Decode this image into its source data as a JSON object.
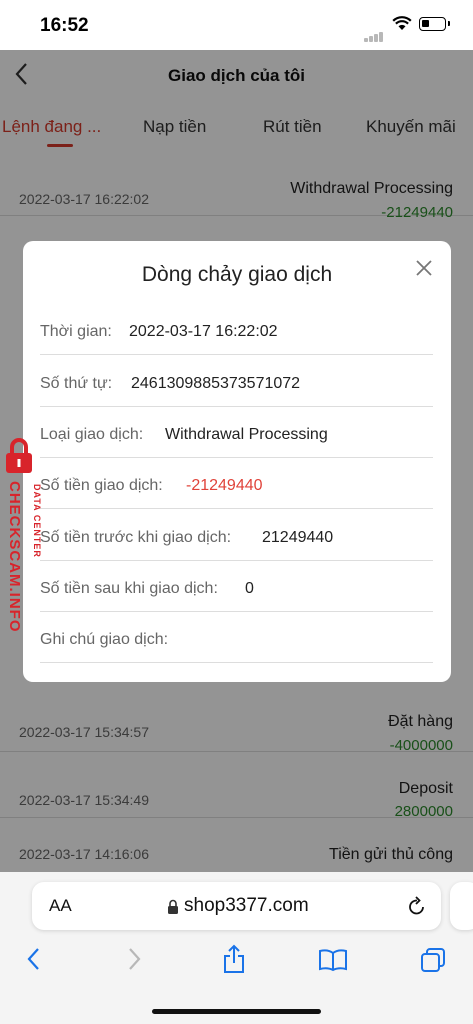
{
  "status_bar": {
    "time": "16:52"
  },
  "header": {
    "title": "Giao dịch của tôi"
  },
  "tabs": [
    {
      "label": "Lệnh đang ...",
      "active": true
    },
    {
      "label": "Nạp tiền"
    },
    {
      "label": "Rút tiền"
    },
    {
      "label": "Khuyến mãi"
    }
  ],
  "transactions": [
    {
      "date": "2022-03-17 16:22:02",
      "type": "Withdrawal Processing",
      "amount": "-21249440"
    },
    {
      "date": "2022-03-17 15:34:57",
      "type": "Đặt hàng",
      "amount": "-4000000"
    },
    {
      "date": "2022-03-17 15:34:49",
      "type": "Deposit",
      "amount": "2800000"
    },
    {
      "date": "2022-03-17 14:16:06",
      "type": "Tiền gửi thủ công",
      "amount": ""
    }
  ],
  "modal": {
    "title": "Dòng chảy giao dịch",
    "fields": [
      {
        "label": "Thời gian:",
        "value": "2022-03-17 16:22:02"
      },
      {
        "label": "Số thứ tự:",
        "value": "2461309885373571072"
      },
      {
        "label": "Loại giao dịch:",
        "value": "Withdrawal Processing"
      },
      {
        "label": "Số tiền giao dịch:",
        "value": "-21249440"
      },
      {
        "label": "Số tiền trước khi giao dịch:",
        "value": "21249440"
      },
      {
        "label": "Số tiền sau khi giao dịch:",
        "value": "0"
      },
      {
        "label": "Ghi chú giao dịch:",
        "value": ""
      }
    ]
  },
  "watermark": {
    "line1": "DATA CENTER",
    "line2": "CHECKSCAM.INFO"
  },
  "browser": {
    "text_size": "AA",
    "url": "shop3377.com"
  },
  "colors": {
    "accent": "#d63a2b",
    "positive": "#2c8a2c",
    "negative": "#e0433a",
    "ios_blue": "#1a73e8"
  },
  "icons": [
    "back-icon",
    "close-icon",
    "lock-icon",
    "reload-icon",
    "share-icon",
    "bookmarks-icon",
    "tabs-icon",
    "wifi-icon",
    "battery-icon"
  ]
}
